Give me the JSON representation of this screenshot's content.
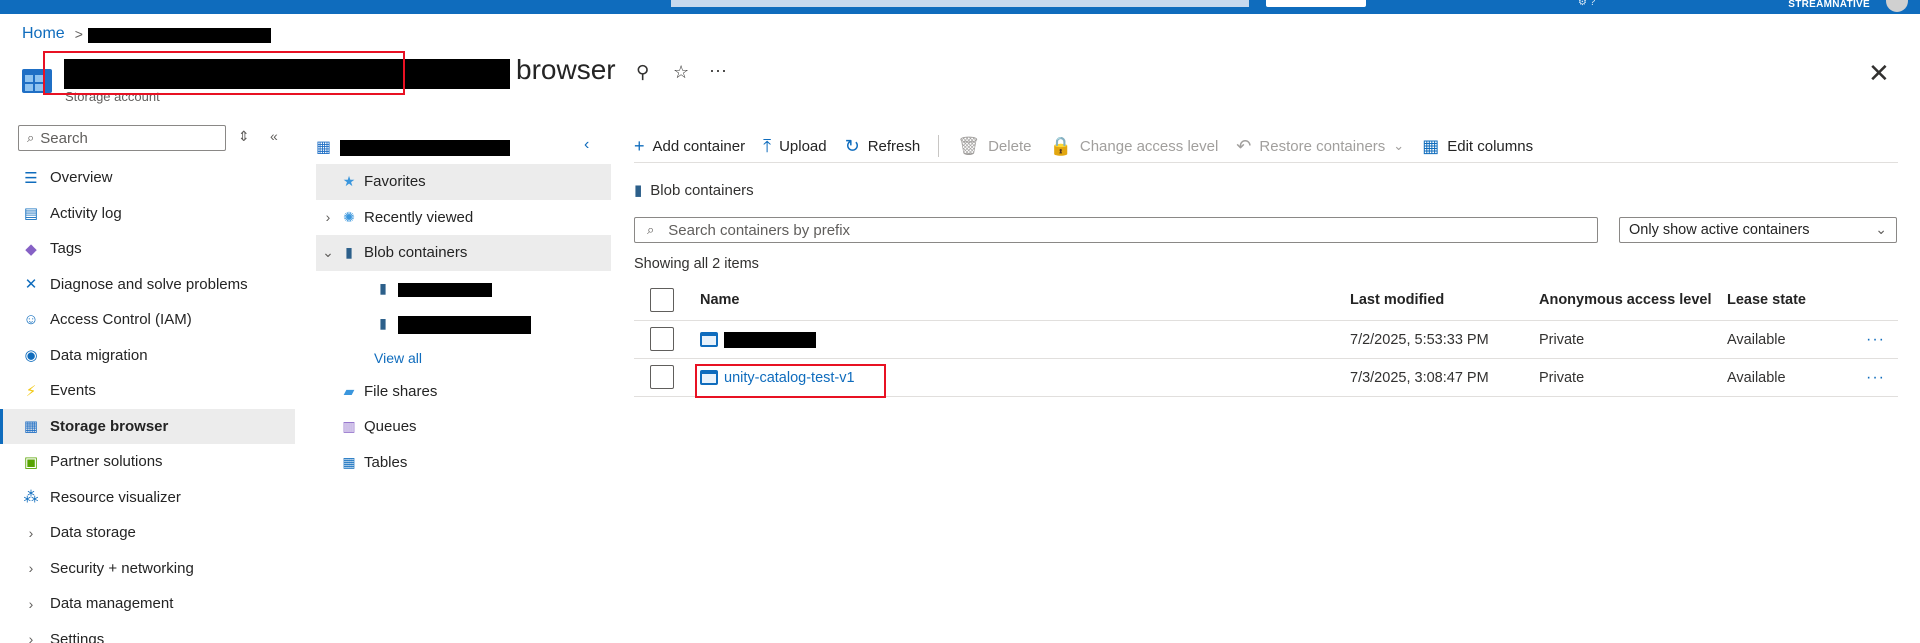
{
  "topbar": {
    "org": "STREAMNATIVE"
  },
  "breadcrumb": {
    "home": "Home",
    "separator": ">"
  },
  "header": {
    "title_suffix": "browser",
    "subtitle": "Storage account",
    "pin": "⚲",
    "star": "☆",
    "more": "···",
    "close": "✕"
  },
  "nav": {
    "search_placeholder": "Search",
    "items": [
      {
        "label": "Overview",
        "icon": "overview-icon"
      },
      {
        "label": "Activity log",
        "icon": "activity-log-icon"
      },
      {
        "label": "Tags",
        "icon": "tag-icon"
      },
      {
        "label": "Diagnose and solve problems",
        "icon": "wrench-icon"
      },
      {
        "label": "Access Control (IAM)",
        "icon": "people-icon"
      },
      {
        "label": "Data migration",
        "icon": "migration-icon"
      },
      {
        "label": "Events",
        "icon": "lightning-icon"
      },
      {
        "label": "Storage browser",
        "icon": "storage-browser-icon"
      },
      {
        "label": "Partner solutions",
        "icon": "partner-icon"
      },
      {
        "label": "Resource visualizer",
        "icon": "visualizer-icon"
      },
      {
        "label": "Data storage",
        "icon": "chevron-right-icon"
      },
      {
        "label": "Security + networking",
        "icon": "chevron-right-icon"
      },
      {
        "label": "Data management",
        "icon": "chevron-right-icon"
      },
      {
        "label": "Settings",
        "icon": "chevron-right-icon"
      }
    ]
  },
  "tree": {
    "favorites": "Favorites",
    "recently_viewed": "Recently viewed",
    "blob_containers": "Blob containers",
    "view_all": "View all",
    "file_shares": "File shares",
    "queues": "Queues",
    "tables": "Tables"
  },
  "toolbar": {
    "add_container": "Add container",
    "upload": "Upload",
    "refresh": "Refresh",
    "delete": "Delete",
    "change_access": "Change access level",
    "restore": "Restore containers",
    "edit_columns": "Edit columns"
  },
  "main": {
    "section": "Blob containers",
    "search_placeholder": "Search containers by prefix",
    "filter": "Only show active containers",
    "showing": "Showing all 2 items",
    "columns": {
      "name": "Name",
      "modified": "Last modified",
      "anon": "Anonymous access level",
      "lease": "Lease state"
    },
    "rows": [
      {
        "name": "",
        "modified": "7/2/2025, 5:53:33 PM",
        "anon": "Private",
        "lease": "Available",
        "more": "···"
      },
      {
        "name": "unity-catalog-test-v1",
        "modified": "7/3/2025, 3:08:47 PM",
        "anon": "Private",
        "lease": "Available",
        "more": "···"
      }
    ]
  }
}
